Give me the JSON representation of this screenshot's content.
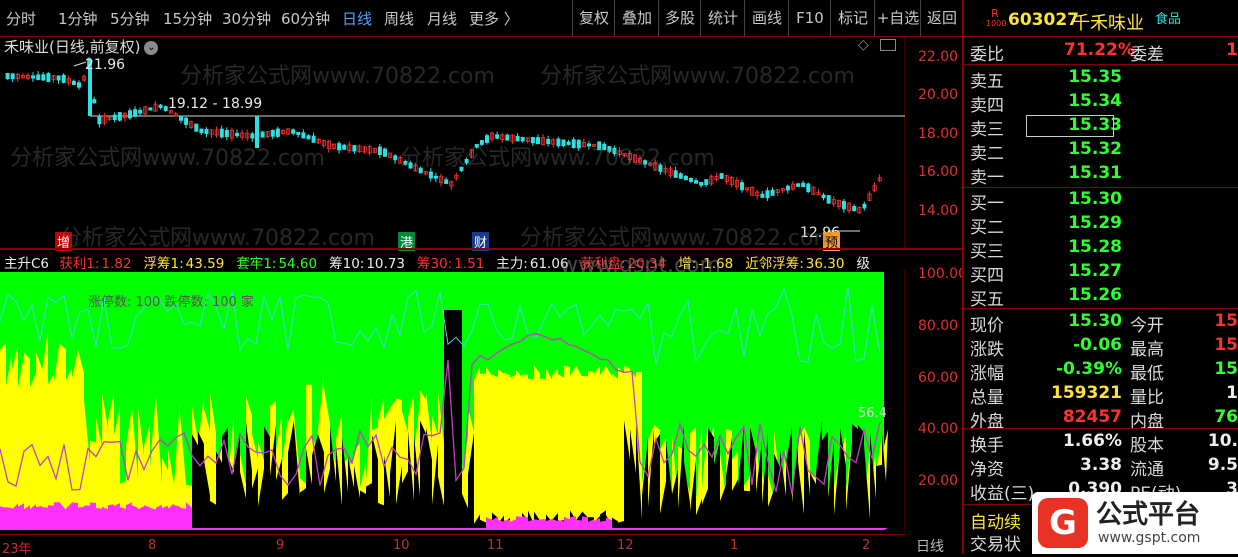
{
  "toolbar": {
    "periods": [
      "分时",
      "1分钟",
      "5分钟",
      "15分钟",
      "30分钟",
      "60分钟",
      "日线",
      "周线",
      "月线",
      "更多 〉"
    ],
    "active_period": "日线",
    "tools": [
      "复权",
      "叠加",
      "多股",
      "统计",
      "画线",
      "F10",
      "标记",
      "+自选",
      "返回"
    ]
  },
  "chart": {
    "title": "禾味业(日线,前复权)",
    "axis_labels": [
      "22.00",
      "20.00",
      "18.00",
      "16.00",
      "14.00"
    ],
    "annotations": {
      "high": "21.96",
      "range": "19.12 - 18.99",
      "low": "12.96"
    },
    "markers": [
      "增",
      "港",
      "财",
      "预"
    ]
  },
  "indicator": {
    "name": "主升C6",
    "items": [
      {
        "label": "获利1:",
        "value": "1.82",
        "color": "#ff3030"
      },
      {
        "label": "浮筹1:",
        "value": "43.59",
        "color": "#ffe23a"
      },
      {
        "label": "套牢1:",
        "value": "54.60",
        "color": "#30ff30"
      },
      {
        "label": "筹10:",
        "value": "10.73",
        "color": "#eeeeee"
      },
      {
        "label": "筹30:",
        "value": "1.51",
        "color": "#ff3030"
      },
      {
        "label": "主力:",
        "value": "61.06",
        "color": "#eeeeee"
      },
      {
        "label": "获利盘:",
        "value": "20.34",
        "color": "#ff3030"
      },
      {
        "label": "增:",
        "value": "-1.68",
        "color": "#ffe23a"
      },
      {
        "label": "近邻浮筹:",
        "value": "36.30",
        "color": "#ffe23a"
      },
      {
        "label": "级",
        "value": "",
        "color": "#eeeeee"
      }
    ],
    "inner_text": "涨停数: 100 跌停数: 100 家",
    "axis_labels": [
      "100.00",
      "80.00",
      "60.00",
      "40.00",
      "20.00"
    ],
    "last_value": "56.4",
    "dates": [
      "23年",
      "8",
      "9",
      "10",
      "11",
      "12",
      "1",
      "2"
    ],
    "period_label": "日线"
  },
  "quote": {
    "code": "603027",
    "name": "千禾味业",
    "tag": "食品",
    "badge_top": "R",
    "badge_bottom": "1000",
    "wei_bi_label": "委比",
    "wei_bi": "71.22%",
    "wei_cha_label": "委差",
    "wei_cha": "1",
    "asks": [
      {
        "label": "卖五",
        "price": "15.35"
      },
      {
        "label": "卖四",
        "price": "15.34"
      },
      {
        "label": "卖三",
        "price": "15.33"
      },
      {
        "label": "卖二",
        "price": "15.32"
      },
      {
        "label": "卖一",
        "price": "15.31"
      }
    ],
    "bids": [
      {
        "label": "买一",
        "price": "15.30"
      },
      {
        "label": "买二",
        "price": "15.29"
      },
      {
        "label": "买三",
        "price": "15.28"
      },
      {
        "label": "买四",
        "price": "15.27"
      },
      {
        "label": "买五",
        "price": "15.26"
      }
    ],
    "stats": [
      {
        "l1": "现价",
        "v1": "15.30",
        "c1": "green",
        "l2": "今开",
        "v2": "15",
        "c2": "red"
      },
      {
        "l1": "涨跌",
        "v1": "-0.06",
        "c1": "green",
        "l2": "最高",
        "v2": "15",
        "c2": "red"
      },
      {
        "l1": "涨幅",
        "v1": "-0.39%",
        "c1": "green",
        "l2": "最低",
        "v2": "15",
        "c2": "green"
      },
      {
        "l1": "总量",
        "v1": "159321",
        "c1": "yellow",
        "l2": "量比",
        "v2": "1",
        "c2": "white"
      },
      {
        "l1": "外盘",
        "v1": "82457",
        "c1": "red",
        "l2": "内盘",
        "v2": "76",
        "c2": "green"
      },
      {
        "l1": "换手",
        "v1": "1.66%",
        "c1": "white",
        "l2": "股本",
        "v2": "10.",
        "c2": "white"
      },
      {
        "l1": "净资",
        "v1": "3.38",
        "c1": "white",
        "l2": "流通",
        "v2": "9.5",
        "c2": "white"
      },
      {
        "l1": "收益(三)",
        "v1": "0.390",
        "c1": "white",
        "l2": "PE(动)",
        "v2": "3",
        "c2": "white"
      }
    ],
    "auto_label": "自动续",
    "trade_label": "交易状"
  },
  "watermarks": [
    "分析家公式网www.70822.com",
    "www.gspt.com",
    "公式平台",
    "www.gspt.com"
  ],
  "colors": {
    "up": "#ff3030",
    "down": "#30e0e0",
    "green": "#30ff30",
    "yellow": "#ffff00",
    "magenta": "#ff30ff"
  }
}
